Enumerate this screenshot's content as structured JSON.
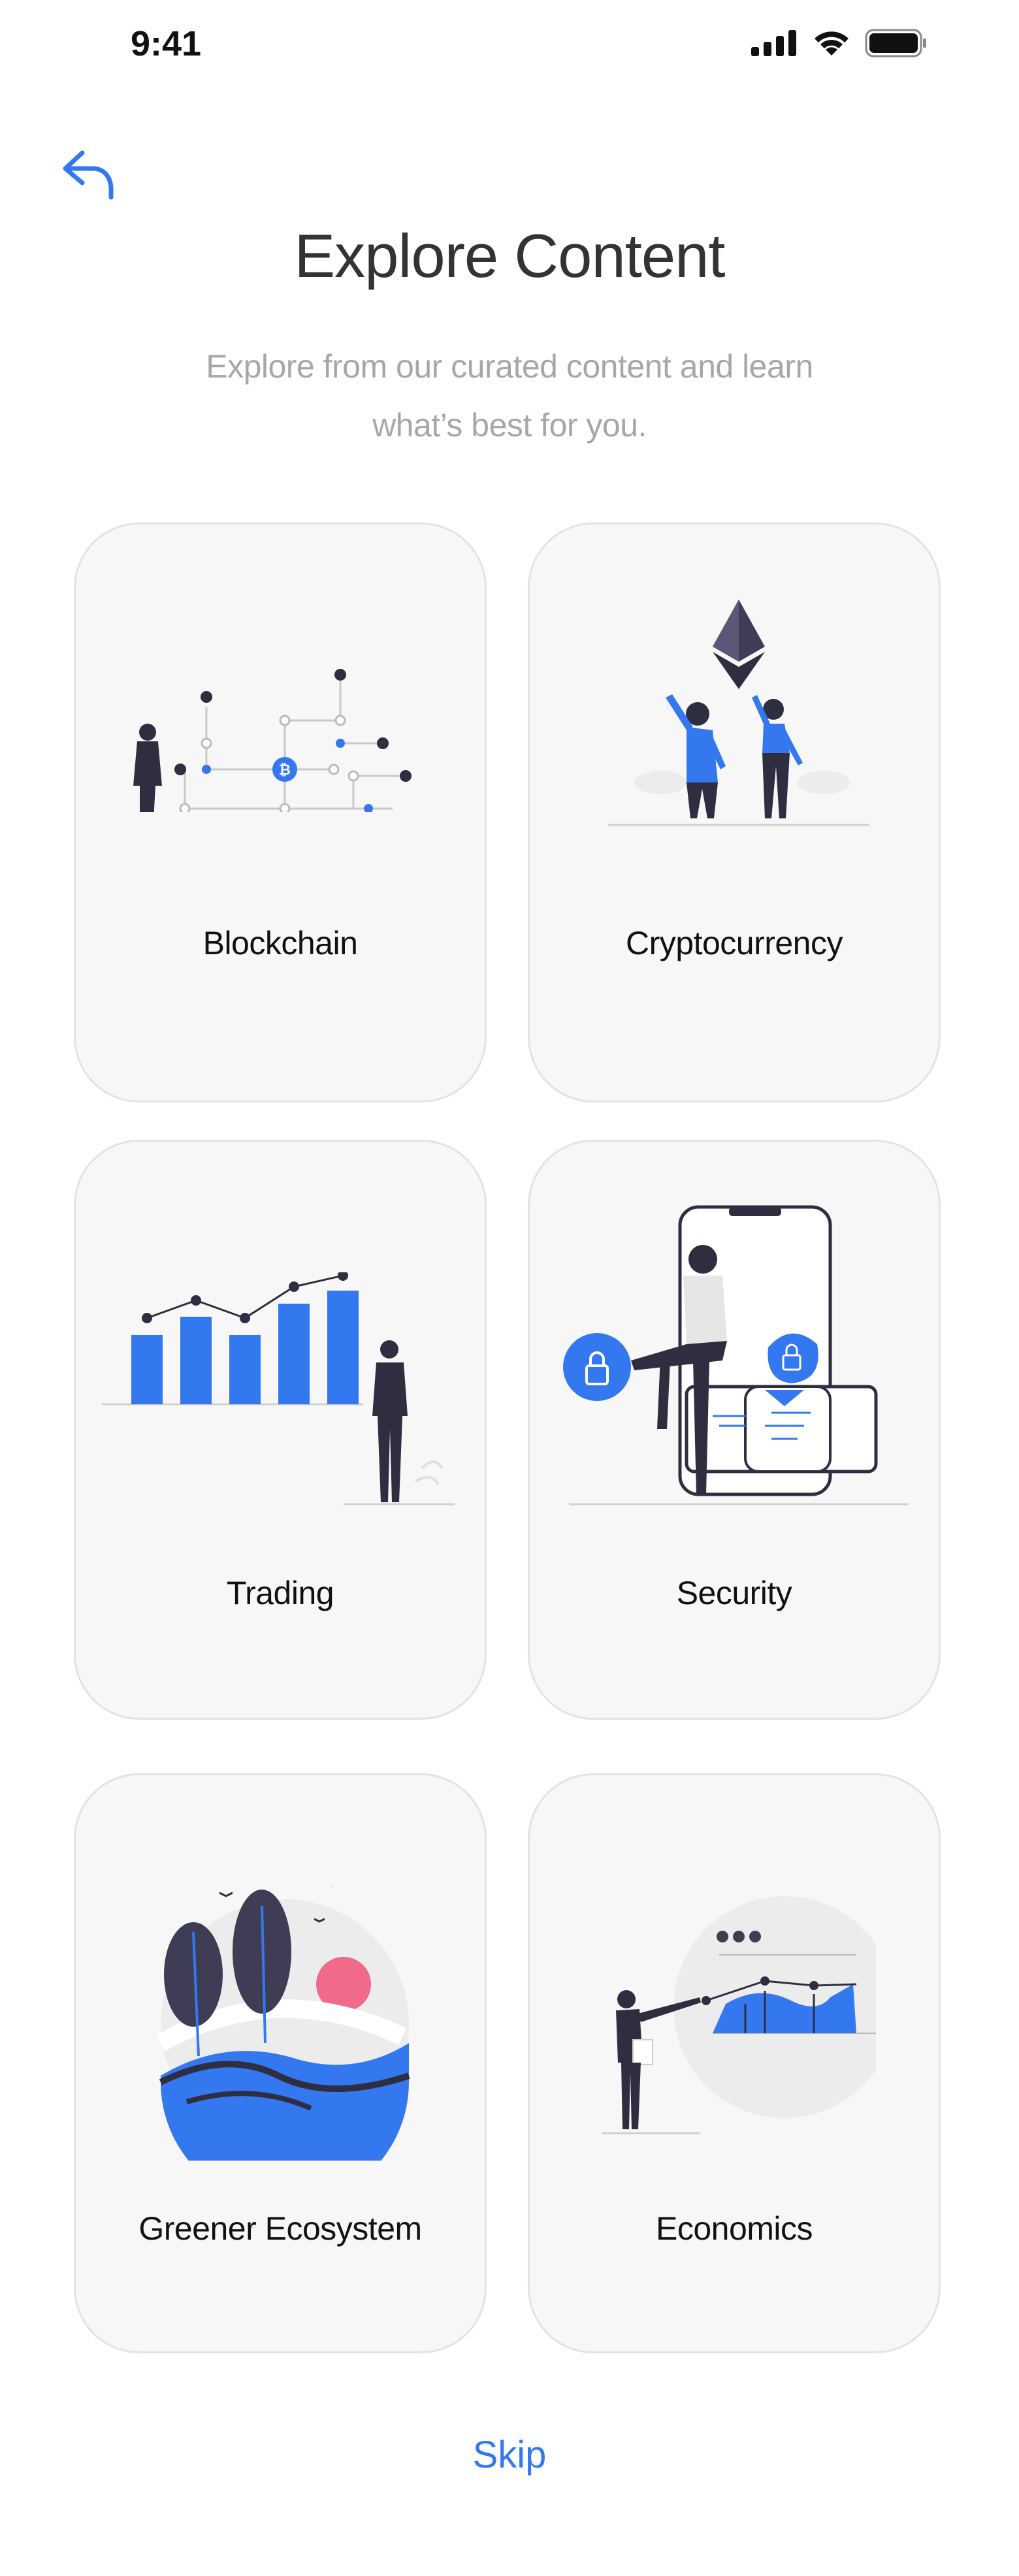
{
  "status": {
    "time": "9:41"
  },
  "header": {
    "title": "Explore Content",
    "subtitle_line1": "Explore from our curated content and learn",
    "subtitle_line2": "what’s best for you."
  },
  "cards": [
    {
      "label": "Blockchain",
      "icon": "blockchain-illustration"
    },
    {
      "label": "Cryptocurrency",
      "icon": "cryptocurrency-illustration"
    },
    {
      "label": "Trading",
      "icon": "trading-illustration"
    },
    {
      "label": "Security",
      "icon": "security-illustration"
    },
    {
      "label": "Greener Ecosystem",
      "icon": "greener-ecosystem-illustration"
    },
    {
      "label": "Economics",
      "icon": "economics-illustration"
    }
  ],
  "footer": {
    "skip_label": "Skip"
  },
  "colors": {
    "accent": "#3478f0",
    "card_bg": "#f7f7f7",
    "card_border": "#e3e3e3",
    "title": "#333333",
    "subtitle": "#a7a7a7",
    "dark": "#2f2e41",
    "pink": "#f06a8a"
  }
}
